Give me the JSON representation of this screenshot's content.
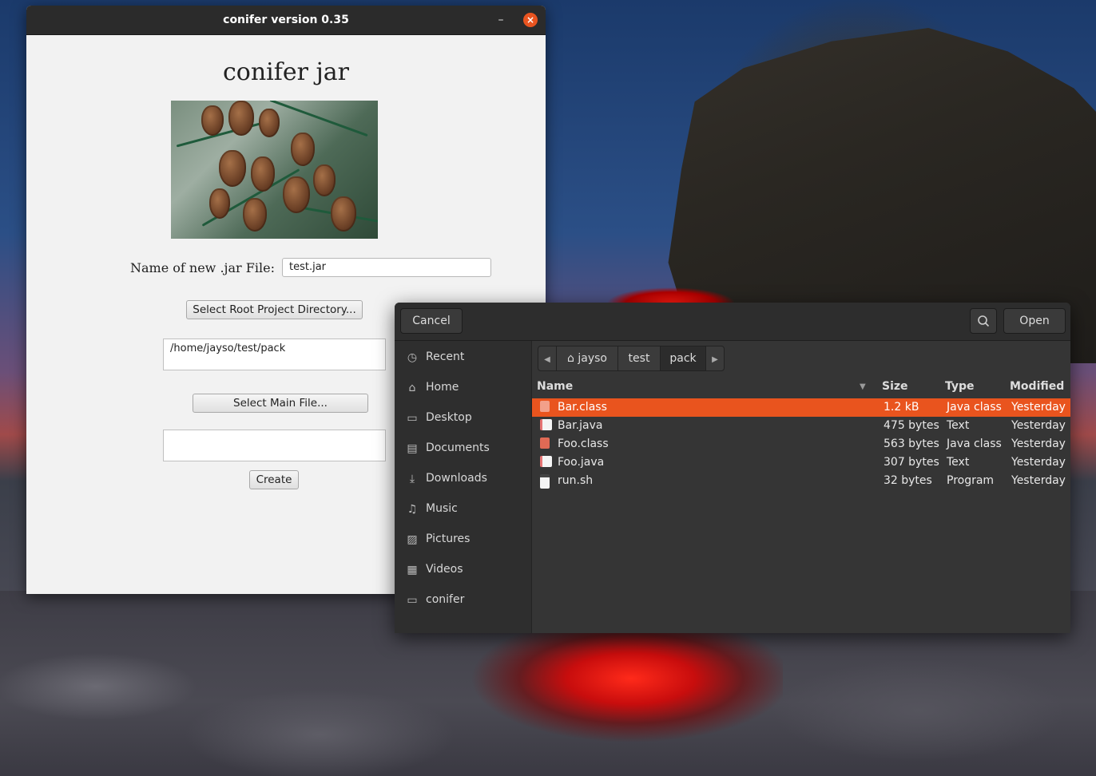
{
  "app_window": {
    "title": "conifer version 0.35",
    "minimize_glyph": "–",
    "close_glyph": "×",
    "heading": "conifer jar",
    "name_label": "Name of new .jar File:",
    "name_value": "test.jar",
    "select_root_label": "Select Root Project Directory...",
    "root_path_value": "/home/jayso/test/pack",
    "select_main_label": "Select Main File...",
    "main_file_value": "",
    "create_label": "Create"
  },
  "file_dialog": {
    "cancel_label": "Cancel",
    "open_label": "Open",
    "search_icon": "search-icon",
    "path": [
      "jayso",
      "test",
      "pack"
    ],
    "sidebar": [
      {
        "label": "Recent",
        "icon": "clock-icon",
        "glyph": "◷"
      },
      {
        "label": "Home",
        "icon": "home-icon",
        "glyph": "⌂"
      },
      {
        "label": "Desktop",
        "icon": "desktop-icon",
        "glyph": "▭"
      },
      {
        "label": "Documents",
        "icon": "documents-icon",
        "glyph": "▤"
      },
      {
        "label": "Downloads",
        "icon": "download-icon",
        "glyph": "⤓"
      },
      {
        "label": "Music",
        "icon": "music-icon",
        "glyph": "♫"
      },
      {
        "label": "Pictures",
        "icon": "pictures-icon",
        "glyph": "▨"
      },
      {
        "label": "Videos",
        "icon": "videos-icon",
        "glyph": "▦"
      },
      {
        "label": "conifer",
        "icon": "folder-icon",
        "glyph": "▭"
      }
    ],
    "columns": {
      "name": "Name",
      "size": "Size",
      "type": "Type",
      "modified": "Modified"
    },
    "files": [
      {
        "name": "Bar.class",
        "size": "1.2 kB",
        "type": "Java class",
        "modified": "Yesterday",
        "icon": "java-class-icon",
        "selected": true
      },
      {
        "name": "Bar.java",
        "size": "475 bytes",
        "type": "Text",
        "modified": "Yesterday",
        "icon": "java-source-icon",
        "selected": false
      },
      {
        "name": "Foo.class",
        "size": "563 bytes",
        "type": "Java class",
        "modified": "Yesterday",
        "icon": "java-class-icon",
        "selected": false
      },
      {
        "name": "Foo.java",
        "size": "307 bytes",
        "type": "Text",
        "modified": "Yesterday",
        "icon": "java-source-icon",
        "selected": false
      },
      {
        "name": "run.sh",
        "size": "32 bytes",
        "type": "Program",
        "modified": "Yesterday",
        "icon": "script-icon",
        "selected": false
      }
    ]
  },
  "colors": {
    "accent": "#e9541e",
    "dialog_bg": "#353535",
    "titlebar_bg": "#2b2b2b",
    "window_bg": "#f2f2f2"
  }
}
